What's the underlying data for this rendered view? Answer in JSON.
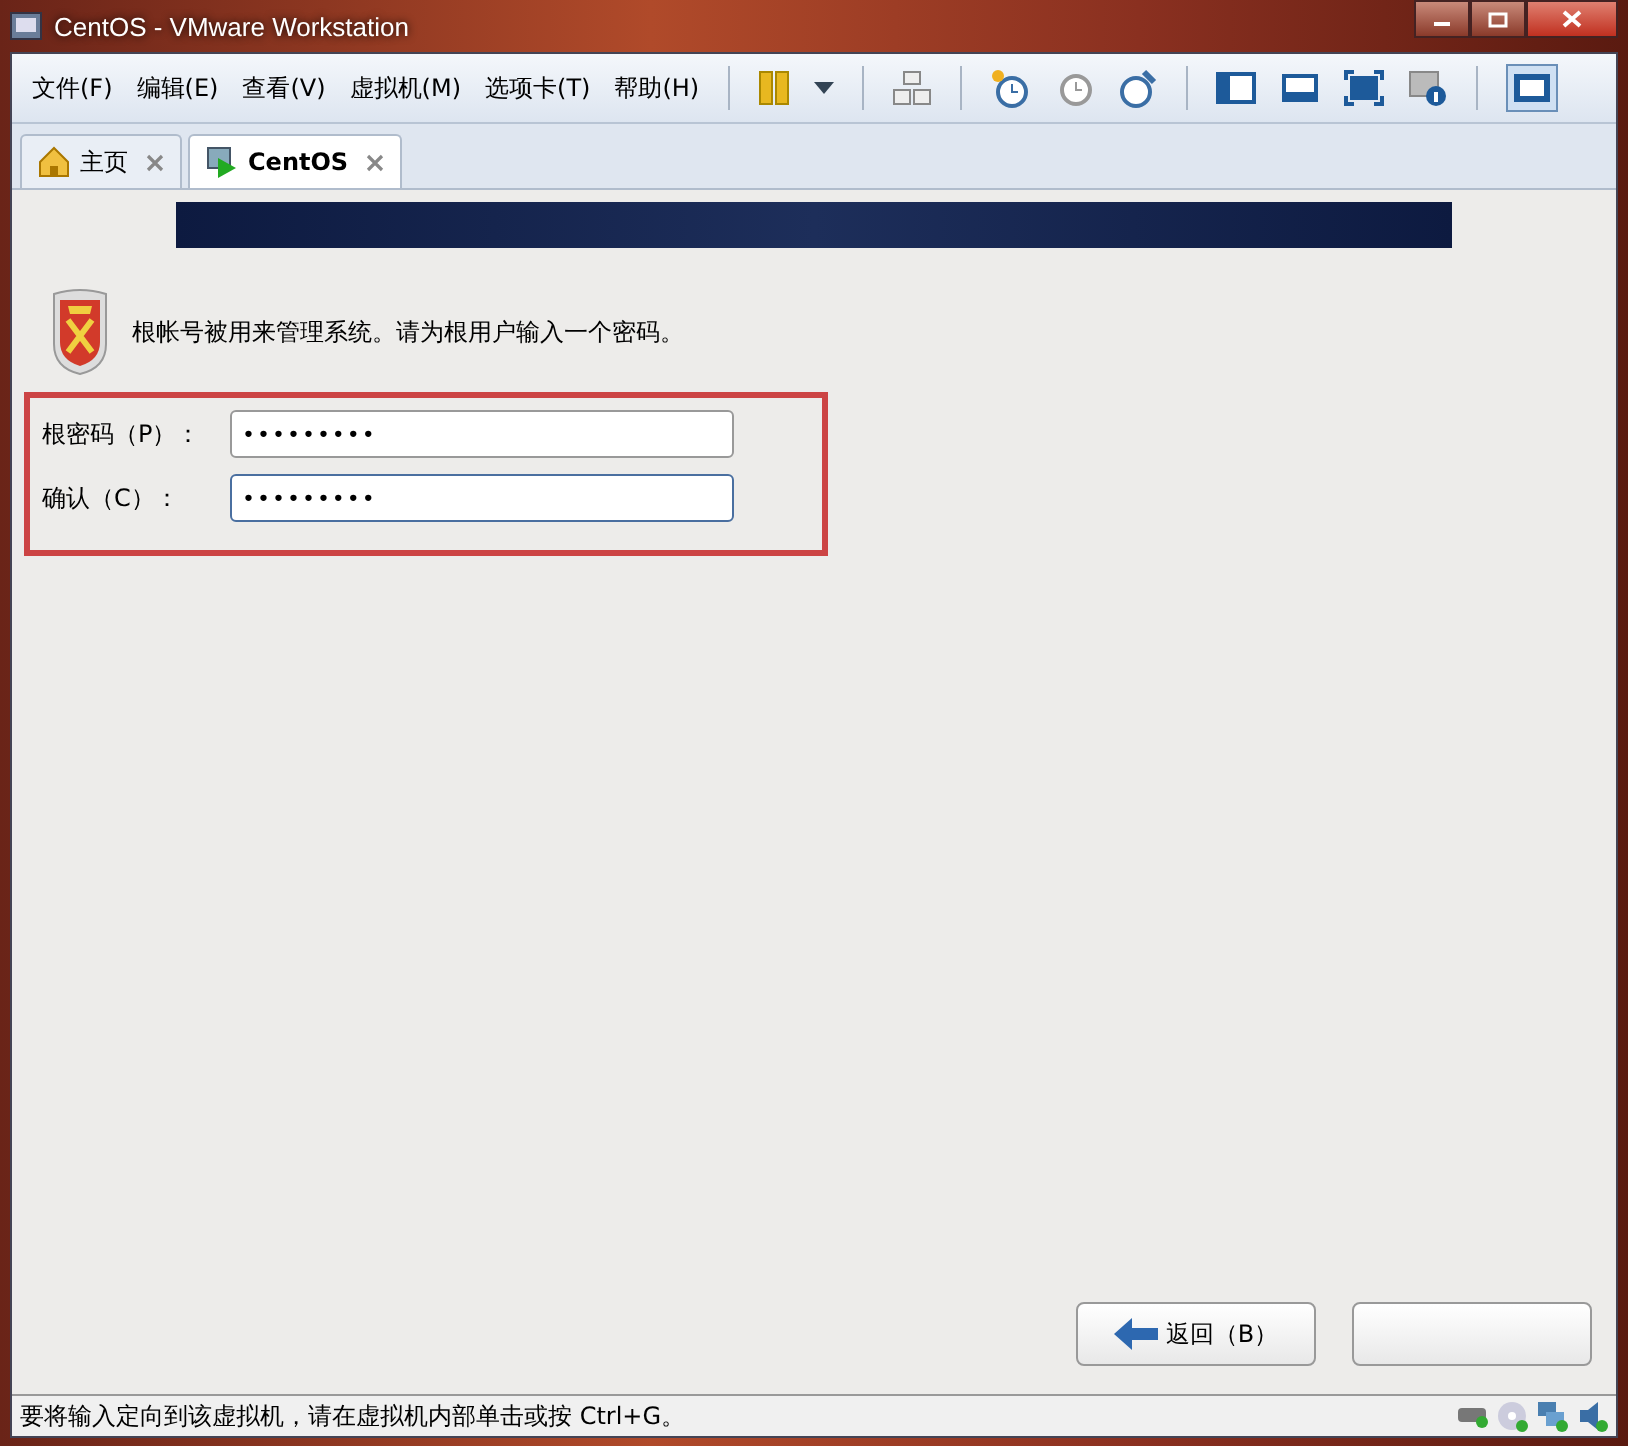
{
  "window": {
    "title": "CentOS - VMware Workstation"
  },
  "menu": [
    {
      "label": "文件(F)"
    },
    {
      "label": "编辑(E)"
    },
    {
      "label": "查看(V)"
    },
    {
      "label": "虚拟机(M)"
    },
    {
      "label": "选项卡(T)"
    },
    {
      "label": "帮助(H)"
    }
  ],
  "tabs": [
    {
      "label": "主页",
      "selected": false
    },
    {
      "label": "CentOS",
      "selected": true
    }
  ],
  "installer": {
    "message": "根帐号被用来管理系统。请为根用户输入一个密码。",
    "fields": [
      {
        "label": "根密码（P）：",
        "value": "•••••••••",
        "focused": false
      },
      {
        "label": "确认（C）：",
        "value": "•••••••••",
        "focused": true
      }
    ],
    "buttons": [
      {
        "label": "返回（B）",
        "kind": "back"
      },
      {
        "kind": "next"
      }
    ]
  },
  "status_bar": {
    "text": "要将输入定向到该虚拟机，请在虚拟机内部单击或按 Ctrl+G。"
  }
}
